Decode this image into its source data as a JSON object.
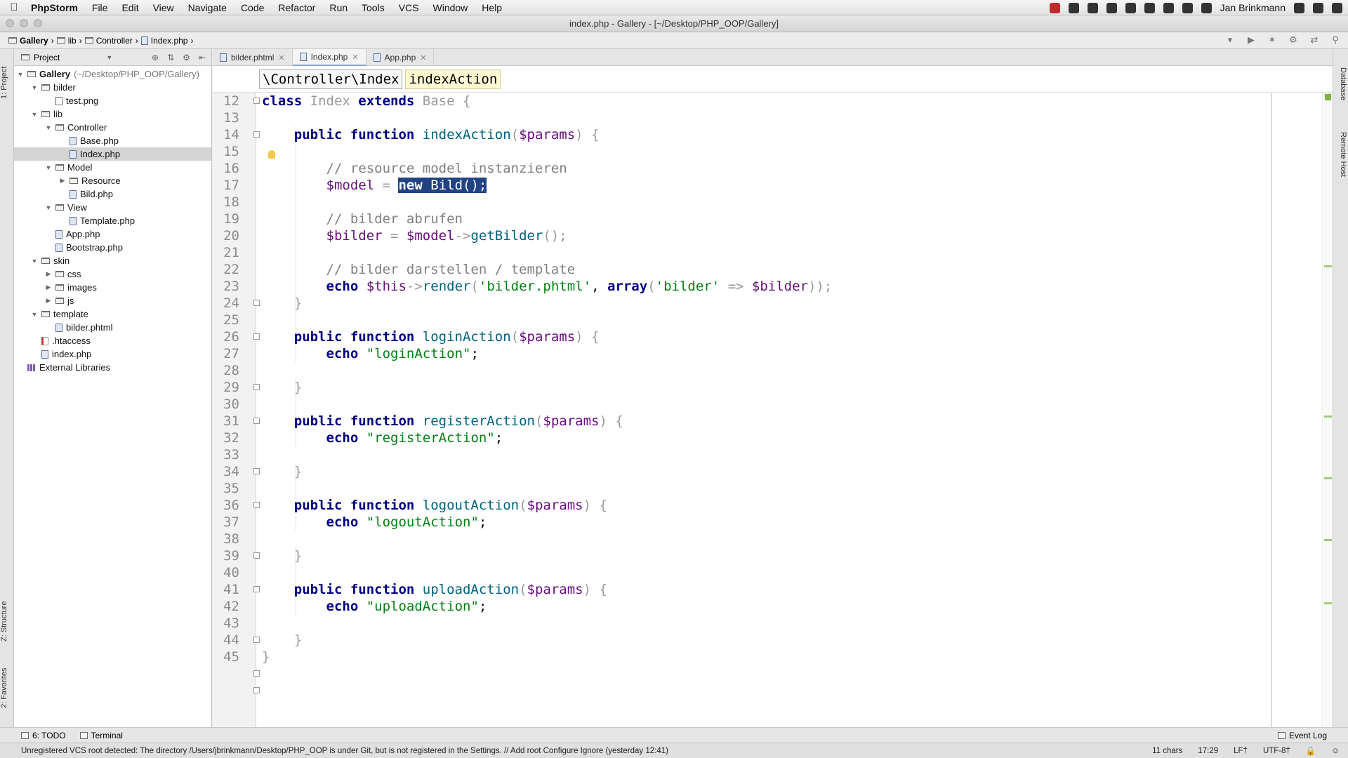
{
  "menubar": {
    "app": "PhpStorm",
    "items": [
      "File",
      "Edit",
      "View",
      "Navigate",
      "Code",
      "Refactor",
      "Run",
      "Tools",
      "VCS",
      "Window",
      "Help"
    ],
    "user": "Jan Brinkmann"
  },
  "window": {
    "title": "index.php - Gallery - [~/Desktop/PHP_OOP/Gallery]"
  },
  "navbar": {
    "crumbs": [
      "Gallery",
      "lib",
      "Controller",
      "Index.php"
    ]
  },
  "project": {
    "header": "Project",
    "tree": [
      {
        "label": "Gallery",
        "suffix": "(~/Desktop/PHP_OOP/Gallery)",
        "type": "folder",
        "open": true
      },
      {
        "label": "bilder",
        "type": "folder",
        "open": true
      },
      {
        "label": "test.png",
        "type": "image"
      },
      {
        "label": "lib",
        "type": "folder",
        "open": true
      },
      {
        "label": "Controller",
        "type": "folder",
        "open": true
      },
      {
        "label": "Base.php",
        "type": "php"
      },
      {
        "label": "Index.php",
        "type": "php",
        "selected": true
      },
      {
        "label": "Model",
        "type": "folder",
        "open": true
      },
      {
        "label": "Resource",
        "type": "folder",
        "open": false
      },
      {
        "label": "Bild.php",
        "type": "php"
      },
      {
        "label": "View",
        "type": "folder",
        "open": true
      },
      {
        "label": "Template.php",
        "type": "php"
      },
      {
        "label": "App.php",
        "type": "php"
      },
      {
        "label": "Bootstrap.php",
        "type": "php"
      },
      {
        "label": "skin",
        "type": "folder",
        "open": true
      },
      {
        "label": "css",
        "type": "folder",
        "open": false
      },
      {
        "label": "images",
        "type": "folder",
        "open": false
      },
      {
        "label": "js",
        "type": "folder",
        "open": false
      },
      {
        "label": "template",
        "type": "folder",
        "open": true
      },
      {
        "label": "bilder.phtml",
        "type": "php"
      },
      {
        "label": ".htaccess",
        "type": "htaccess"
      },
      {
        "label": "index.php",
        "type": "php"
      },
      {
        "label": "External Libraries",
        "type": "library"
      }
    ]
  },
  "tool_tabs": {
    "project": "1: Project",
    "structure": "Z: Structure",
    "favorites": "2: Favorites",
    "database": "Database",
    "remote_host": "Remote Host"
  },
  "tabs": [
    {
      "label": "bilder.phtml",
      "active": false
    },
    {
      "label": "Index.php",
      "active": true
    },
    {
      "label": "App.php",
      "active": false
    }
  ],
  "editor_crumbs": {
    "class": "\\Controller\\Index",
    "method": "indexAction"
  },
  "code": {
    "line_numbers": [
      "12",
      "13",
      "14",
      "15",
      "16",
      "17",
      "18",
      "19",
      "20",
      "21",
      "22",
      "23",
      "24",
      "25",
      "26",
      "27",
      "28",
      "29",
      "30",
      "31",
      "32",
      "33",
      "34",
      "35",
      "36",
      "37",
      "38",
      "39",
      "40",
      "41",
      "42",
      "43",
      "44",
      "45"
    ],
    "lines": {
      "l12": {
        "a": "class",
        "b": " Index ",
        "c": "extends",
        "d": " Base {"
      },
      "l14": {
        "a": "public function",
        "b": " indexAction",
        "c": "(",
        "d": "$params",
        "e": ") {"
      },
      "l16": "// resource model instanzieren",
      "l17": {
        "a": "$model",
        "b": " = ",
        "c": "new",
        "d": " Bild();"
      },
      "l19": "// bilder abrufen",
      "l20": {
        "a": "$bilder",
        "b": " = ",
        "c": "$model",
        "d": "->",
        "e": "getBilder",
        "f": "();"
      },
      "l22": "// bilder darstellen / template",
      "l23": {
        "a": "echo",
        "b": "$this",
        "c": "->",
        "d": "render",
        "e": "(",
        "f": "'bilder.phtml'",
        "g": ", ",
        "h": "array",
        "i": "(",
        "j": "'bilder'",
        "k": " => ",
        "l": "$bilder",
        "m": "));"
      },
      "l24": "}",
      "l26": {
        "a": "public function",
        "b": " loginAction",
        "c": "(",
        "d": "$params",
        "e": ") {"
      },
      "l27": {
        "a": "echo",
        "b": "\"loginAction\"",
        "c": ";"
      },
      "l29": "}",
      "l31": {
        "a": "public function",
        "b": " registerAction",
        "c": "(",
        "d": "$params",
        "e": ") {"
      },
      "l32": {
        "a": "echo",
        "b": "\"registerAction\"",
        "c": ";"
      },
      "l34": "}",
      "l36": {
        "a": "public function",
        "b": " logoutAction",
        "c": "(",
        "d": "$params",
        "e": ") {"
      },
      "l37": {
        "a": "echo",
        "b": "\"logoutAction\"",
        "c": ";"
      },
      "l39": "}",
      "l41": {
        "a": "public function",
        "b": " uploadAction",
        "c": "(",
        "d": "$params",
        "e": ") {"
      },
      "l42": {
        "a": "echo",
        "b": "\"uploadAction\"",
        "c": ";"
      },
      "l44": "}",
      "l45": "}"
    }
  },
  "toolwindows": {
    "todo": "6: TODO",
    "terminal": "Terminal",
    "event_log": "Event Log"
  },
  "status": {
    "message": "Unregistered VCS root detected: The directory /Users/jbrinkmann/Desktop/PHP_OOP is under Git, but is not registered in the Settings. // Add root  Configure  Ignore (yesterday 12:41)",
    "chars": "11 chars",
    "position": "17:29",
    "line_sep": "LF†",
    "encoding": "UTF-8†"
  }
}
